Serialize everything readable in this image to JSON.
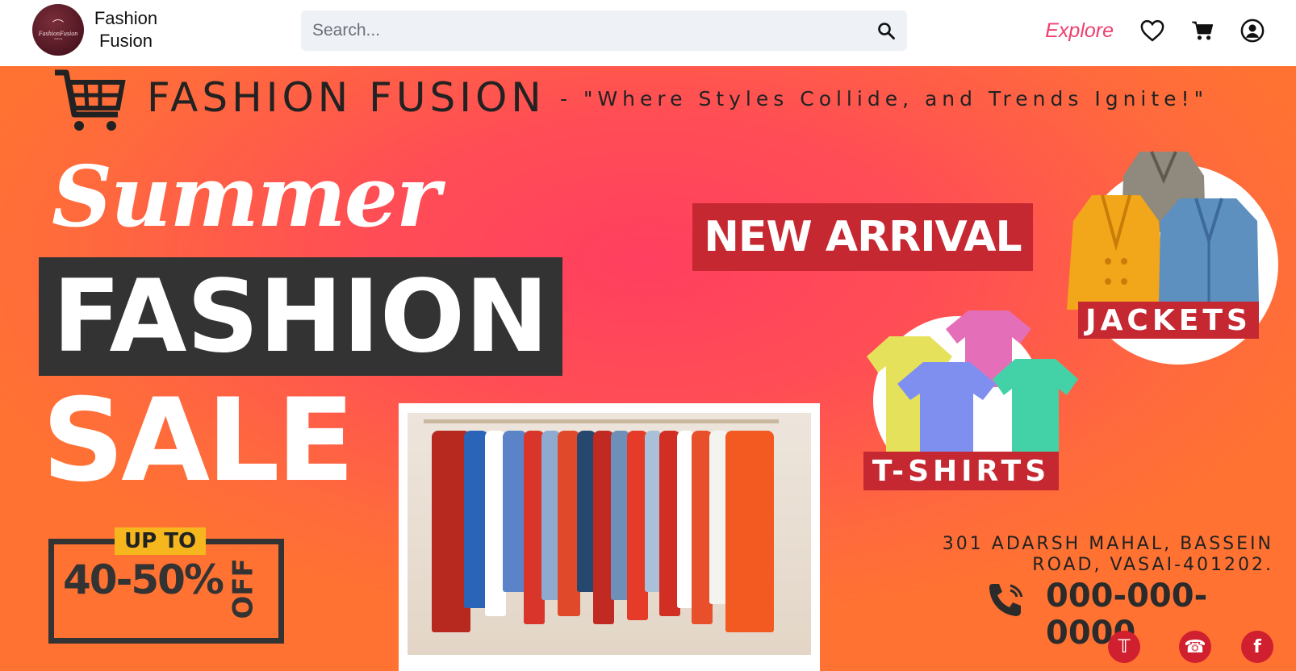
{
  "navbar": {
    "brand": {
      "line1": "Fashion",
      "line2": "Fusion",
      "logo_text": "FashionFusion",
      "logo_sub": "clothing",
      "logo_icon": "hanger-icon"
    },
    "search": {
      "placeholder": "Search...",
      "value": "",
      "icon": "search-icon"
    },
    "explore_label": "Explore",
    "icons": [
      "heart-icon",
      "cart-icon",
      "user-circle-icon"
    ]
  },
  "banner": {
    "title": "FASHION FUSION",
    "tagline": "- \"Where Styles Collide, and Trends Ignite!\"",
    "summer": "Summer",
    "fashion": "FASHION",
    "sale": "SALE",
    "up_to": "UP TO",
    "discount": "40-50%",
    "off": "OFF",
    "new_arrival": "NEW ARRIVAL",
    "jackets": "JACKETS",
    "tshirts": "T-SHIRTS",
    "address_line1": "301 ADARSH MAHAL, BASSEIN",
    "address_line2": "ROAD, VASAI-401202.",
    "phone": "000-000-0000",
    "social_icons": [
      "twitter-icon",
      "whatsapp-icon",
      "facebook-icon"
    ],
    "colors": {
      "accent_red": "#c62832",
      "dark": "#333333",
      "yellow": "#f6b71e",
      "explore_pink": "#ef3f6f"
    }
  }
}
